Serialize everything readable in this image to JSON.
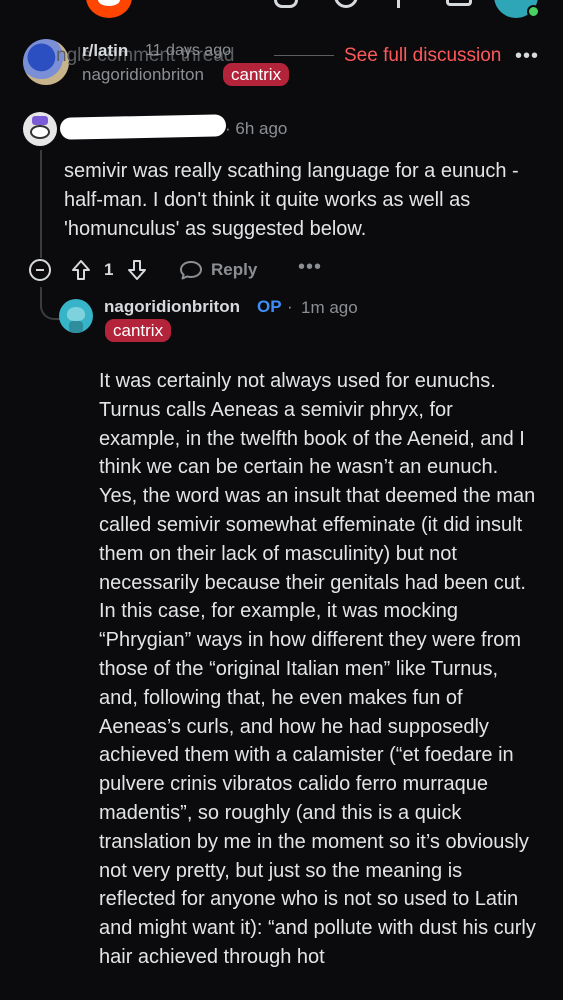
{
  "thread": {
    "ghost_title": "ngle comment thread",
    "subreddit": "r/latin",
    "time": "11 days ago",
    "see_full": "See full discussion",
    "more": "•••",
    "author": "nagoridionbriton",
    "author_flair": "cantrix"
  },
  "comment1": {
    "time": "· 6h ago",
    "body": "semivir was really scathing language for a eunuch - half-man. I don't think it quite works as well as 'homunculus' as suggested below.",
    "votes": "1",
    "reply_label": "Reply",
    "more": "•••"
  },
  "comment2": {
    "author": "nagoridionbriton",
    "op_badge": "OP",
    "dot": "·",
    "time": "1m ago",
    "flair": "cantrix",
    "body": "It was certainly not always used for eunuchs. Turnus calls Aeneas a semivir phryx, for example, in the twelfth book of the Aeneid, and I think we can be certain he wasn’t an eunuch. Yes, the word was an insult that deemed the man called semivir somewhat effeminate (it did insult them on their lack of masculinity) but not necessarily because their genitals had been cut. In this case, for example, it was mocking “Phrygian” ways in how different they were from those of the “original Italian men” like Turnus, and, following that, he even makes fun of Aeneas’s curls, and how he had supposedly achieved them with a calamister (“et foedare in pulvere crinis vibratos calido ferro murraque madentis”, so roughly (and this is a quick translation by me in the moment so it’s obviously not very pretty, but just so the meaning is reflected for anyone who is not so used to Latin and might want it): “and pollute with dust his curly hair achieved through hot"
  },
  "colors": {
    "background": "#0b0b0d",
    "accent_red": "#ff585b",
    "flair_bg": "#b3233a",
    "op_blue": "#3d8ef7",
    "muted": "#8b8f93"
  },
  "icons": [
    "menu-icon",
    "reddit-logo-icon",
    "chat-icon",
    "search-icon",
    "plus-icon",
    "inbox-icon",
    "profile-avatar-icon",
    "collapse-icon",
    "upvote-icon",
    "downvote-icon",
    "reply-icon",
    "more-icon"
  ]
}
